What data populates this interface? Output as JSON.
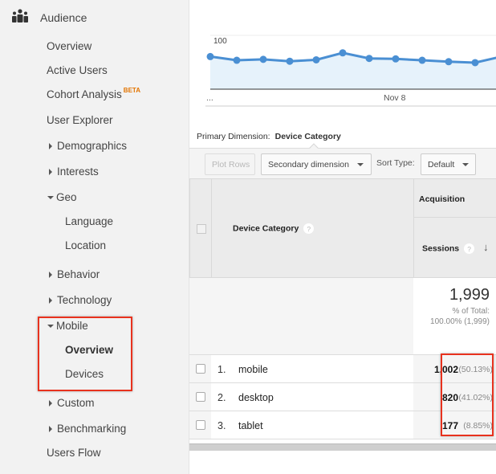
{
  "sidebar": {
    "section_title": "Audience",
    "section_icon": "people-group-icon",
    "items": [
      {
        "label": "Overview",
        "level": 1,
        "expander": "none"
      },
      {
        "label": "Active Users",
        "level": 1,
        "expander": "none"
      },
      {
        "label": "Cohort Analysis",
        "level": 1,
        "expander": "none",
        "badge": "BETA"
      },
      {
        "label": "User Explorer",
        "level": 1,
        "expander": "none"
      },
      {
        "label": "Demographics",
        "level": 1,
        "expander": "collapsed"
      },
      {
        "label": "Interests",
        "level": 1,
        "expander": "collapsed"
      },
      {
        "label": "Geo",
        "level": 1,
        "expander": "expanded"
      },
      {
        "label": "Language",
        "level": 2,
        "expander": "none"
      },
      {
        "label": "Location",
        "level": 2,
        "expander": "none"
      },
      {
        "label": "Behavior",
        "level": 1,
        "expander": "collapsed"
      },
      {
        "label": "Technology",
        "level": 1,
        "expander": "collapsed"
      },
      {
        "label": "Mobile",
        "level": 1,
        "expander": "expanded"
      },
      {
        "label": "Overview",
        "level": 2,
        "expander": "none",
        "active": true
      },
      {
        "label": "Devices",
        "level": 2,
        "expander": "none"
      },
      {
        "label": "Custom",
        "level": 1,
        "expander": "collapsed"
      },
      {
        "label": "Benchmarking",
        "level": 1,
        "expander": "collapsed"
      },
      {
        "label": "Users Flow",
        "level": 1,
        "expander": "none"
      }
    ]
  },
  "chart_data": {
    "type": "area",
    "title": "",
    "xlabel": "",
    "ylabel": "",
    "y_tick_labels": [
      "100"
    ],
    "x_tick_labels": [
      "...",
      "Nov 8"
    ],
    "ylim": [
      0,
      100
    ],
    "series": [
      {
        "name": "Sessions",
        "values": [
          70,
          62,
          64,
          60,
          63,
          78,
          66,
          65,
          62,
          59,
          57,
          70
        ]
      }
    ],
    "colors": {
      "line": "#4a8fd3",
      "fill": "#e6f2fb"
    }
  },
  "report": {
    "primary_dimension_label": "Primary Dimension:",
    "primary_dimension_value": "Device Category",
    "toolbar": {
      "plot_rows": "Plot Rows",
      "secondary_dimension": "Secondary dimension",
      "sort_type_label": "Sort Type:",
      "sort_type_value": "Default"
    },
    "table": {
      "group_header": "Acquisition",
      "dimension_header": "Device Category",
      "metric_header": "Sessions",
      "help_glyph": "?",
      "sort_glyph": "↓",
      "totals": {
        "value": "1,999",
        "pct_line1": "% of Total:",
        "pct_line2": "100.00% (1,999)"
      },
      "rows": [
        {
          "num": "1.",
          "name": "mobile",
          "sessions": "1,002",
          "pct": "(50.13%)"
        },
        {
          "num": "2.",
          "name": "desktop",
          "sessions": "820",
          "pct": "(41.02%)"
        },
        {
          "num": "3.",
          "name": "tablet",
          "sessions": "177",
          "pct": "(8.85%)"
        }
      ]
    }
  }
}
